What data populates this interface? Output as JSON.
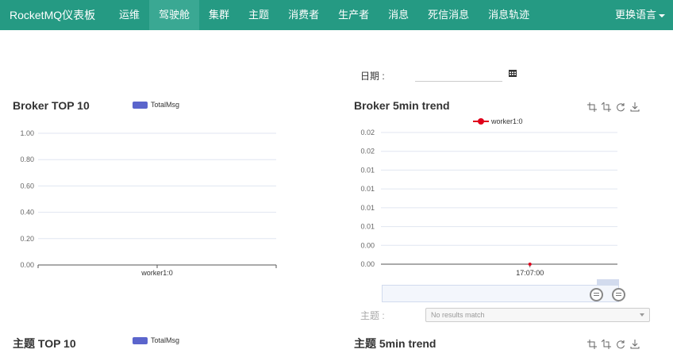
{
  "navbar": {
    "brand": "RocketMQ仪表板",
    "items": [
      {
        "label": "运维"
      },
      {
        "label": "驾驶舱",
        "active": true
      },
      {
        "label": "集群"
      },
      {
        "label": "主题"
      },
      {
        "label": "消费者"
      },
      {
        "label": "生产者"
      },
      {
        "label": "消息"
      },
      {
        "label": "死信消息"
      },
      {
        "label": "消息轨迹"
      }
    ],
    "language": "更换语言"
  },
  "filter": {
    "date_label": "日期 :",
    "date_value": "",
    "topic_label": "主题 :",
    "topic_placeholder": "No results match"
  },
  "colors": {
    "navbar": "#259a83",
    "navbar_active": "#3aa893",
    "bar_series": "#5b65cc",
    "line_series": "#e0001b"
  },
  "icons": [
    "calendar-icon",
    "zoom-icon",
    "zoom-reset-icon",
    "restore-icon",
    "save-image-icon",
    "chevron-down-icon"
  ],
  "charts": {
    "broker_top10": {
      "title": "Broker TOP 10",
      "legend": "TotalMsg"
    },
    "broker_trend": {
      "title": "Broker 5min trend",
      "legend": "worker1:0"
    },
    "topic_top10": {
      "title": "主题 TOP 10",
      "legend": "TotalMsg"
    },
    "topic_trend": {
      "title": "主题 5min trend"
    }
  },
  "chart_data": [
    {
      "type": "bar",
      "title": "Broker TOP 10",
      "categories": [
        "worker1:0"
      ],
      "series": [
        {
          "name": "TotalMsg",
          "values": [
            0
          ]
        }
      ],
      "ylim": [
        0,
        1
      ],
      "y_ticks": [
        "1.00",
        "0.80",
        "0.60",
        "0.40",
        "0.20",
        "0.00"
      ],
      "grid": true,
      "legend": "top"
    },
    {
      "type": "line",
      "title": "Broker 5min trend",
      "x": [
        "17:07:00"
      ],
      "series": [
        {
          "name": "worker1:0",
          "values": [
            0
          ]
        }
      ],
      "y_ticks": [
        "0.02",
        "0.02",
        "0.01",
        "0.01",
        "0.01",
        "0.01",
        "0.00",
        "0.00"
      ],
      "grid": true,
      "legend": "top"
    }
  ]
}
